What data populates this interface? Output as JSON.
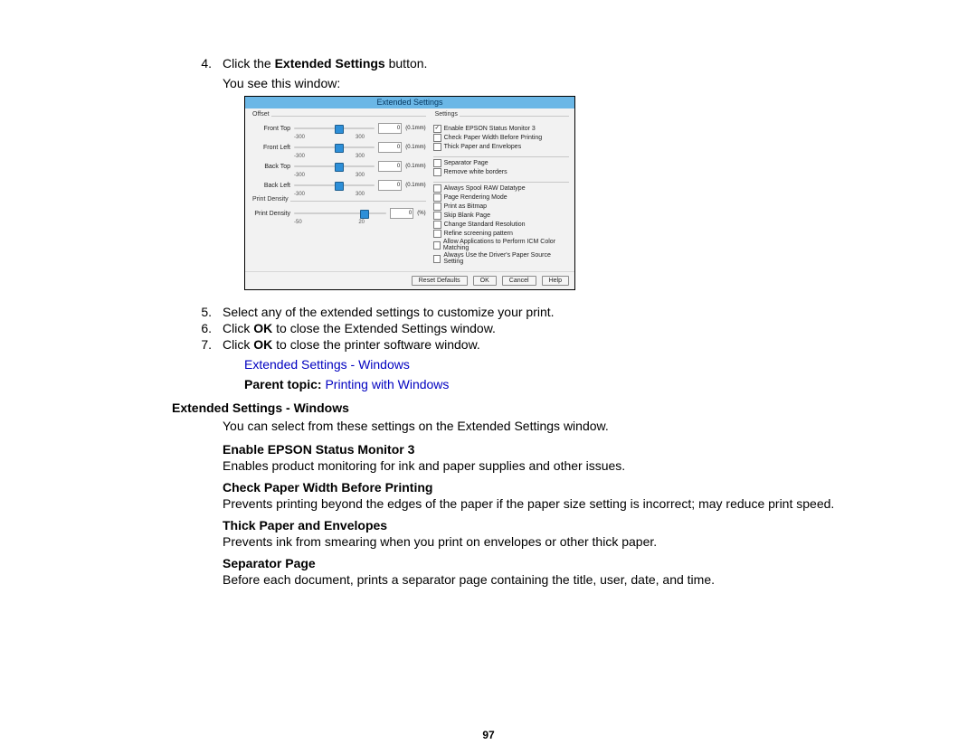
{
  "steps": {
    "s4_prefix": "Click the ",
    "s4_bold": "Extended Settings",
    "s4_suffix": " button.",
    "s4_line2": "You see this window:",
    "s5": "Select any of the extended settings to customize your print.",
    "s6_prefix": "Click ",
    "s6_bold": "OK",
    "s6_suffix": " to close the Extended Settings window.",
    "s7_prefix": "Click ",
    "s7_bold": "OK",
    "s7_suffix": " to close the printer software window."
  },
  "nums": {
    "n4": "4.",
    "n5": "5.",
    "n6": "6.",
    "n7": "7."
  },
  "link_sub": "Extended Settings - Windows",
  "parent_label": "Parent topic:",
  "parent_link": "Printing with Windows",
  "section_heading": "Extended Settings - Windows",
  "section_intro": "You can select from these settings on the Extended Settings window.",
  "defs": {
    "d1h": "Enable EPSON Status Monitor 3",
    "d1b": "Enables product monitoring for ink and paper supplies and other issues.",
    "d2h": "Check Paper Width Before Printing",
    "d2b": "Prevents printing beyond the edges of the paper if the paper size setting is incorrect; may reduce print speed.",
    "d3h": "Thick Paper and Envelopes",
    "d3b": "Prevents ink from smearing when you print on envelopes or other thick paper.",
    "d4h": "Separator Page",
    "d4b": "Before each document, prints a separator page containing the title, user, date, and time."
  },
  "page_number": "97",
  "dialog": {
    "title": "Extended Settings",
    "left": {
      "group_offset": "Offset",
      "group_density": "Print Density",
      "sliders": {
        "front_top": {
          "label": "Front Top",
          "val": "0",
          "unit": "(0.1mm)",
          "min": "-300",
          "max": "300",
          "pos": 50
        },
        "front_left": {
          "label": "Front Left",
          "val": "0",
          "unit": "(0.1mm)",
          "min": "-300",
          "max": "300",
          "pos": 50
        },
        "back_top": {
          "label": "Back Top",
          "val": "0",
          "unit": "(0.1mm)",
          "min": "-300",
          "max": "300",
          "pos": 50
        },
        "back_left": {
          "label": "Back Left",
          "val": "0",
          "unit": "(0.1mm)",
          "min": "-300",
          "max": "300",
          "pos": 50
        },
        "density": {
          "label": "Print Density",
          "val": "0",
          "unit": "(%)",
          "min": "-50",
          "max": "20",
          "pos": 71
        }
      }
    },
    "right": {
      "group_settings": "Settings",
      "opts": [
        {
          "label": "Enable EPSON Status Monitor 3",
          "on": true
        },
        {
          "label": "Check Paper Width Before Printing",
          "on": false
        },
        {
          "label": "Thick Paper and Envelopes",
          "on": false
        }
      ],
      "opts2": [
        {
          "label": "Separator Page",
          "on": false
        },
        {
          "label": "Remove white borders",
          "on": false
        }
      ],
      "opts3": [
        {
          "label": "Always Spool RAW Datatype",
          "on": false
        },
        {
          "label": "Page Rendering Mode",
          "on": false
        },
        {
          "label": "Print as Bitmap",
          "on": false
        },
        {
          "label": "Skip Blank Page",
          "on": false
        },
        {
          "label": "Change Standard Resolution",
          "on": false
        },
        {
          "label": "Refine screening pattern",
          "on": false
        },
        {
          "label": "Allow Applications to Perform ICM Color Matching",
          "on": false
        },
        {
          "label": "Always Use the Driver's Paper Source Setting",
          "on": false
        }
      ]
    },
    "buttons": {
      "reset": "Reset Defaults",
      "ok": "OK",
      "cancel": "Cancel",
      "help": "Help"
    }
  }
}
